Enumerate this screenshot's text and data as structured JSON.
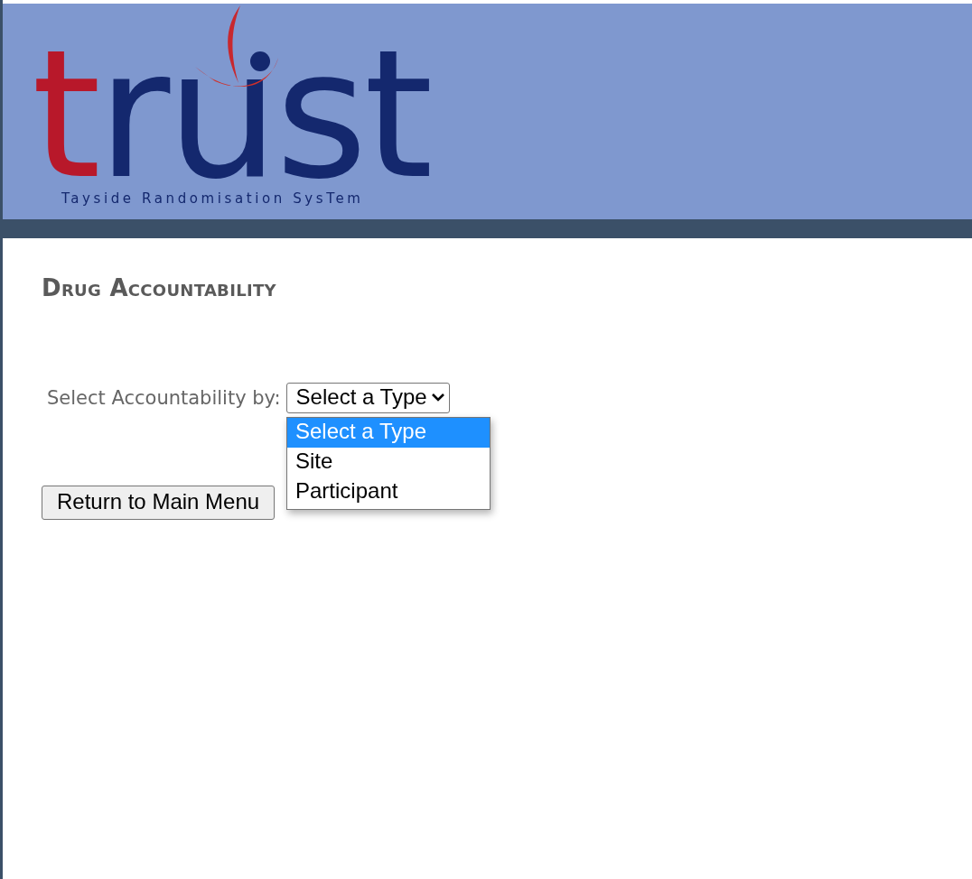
{
  "logo": {
    "word": "trust",
    "subtitle": "Tayside Randomisation SysTem"
  },
  "page": {
    "heading": "Drug Accountability"
  },
  "form": {
    "label": "Select Accountability by:",
    "select": {
      "value": "Select a Type",
      "expanded": true,
      "options": [
        {
          "label": "Select a Type",
          "selected": true
        },
        {
          "label": "Site",
          "selected": false
        },
        {
          "label": "Participant",
          "selected": false
        }
      ]
    }
  },
  "buttons": [
    {
      "label": "Return to Main Menu"
    }
  ]
}
